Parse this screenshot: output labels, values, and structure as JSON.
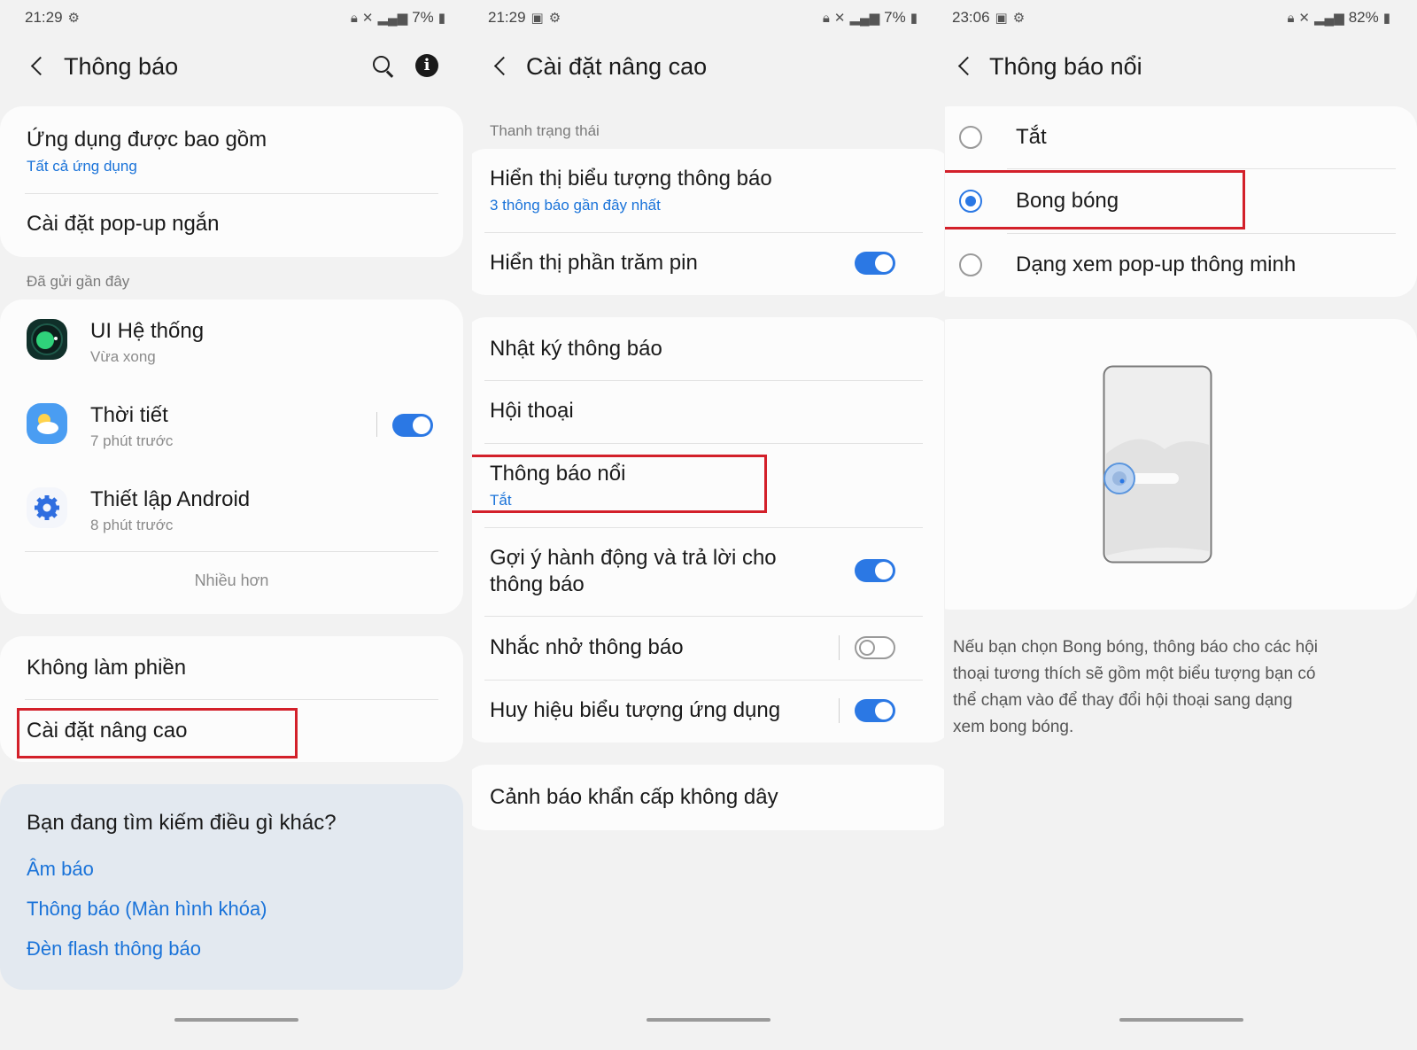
{
  "screen1": {
    "status": {
      "time": "21:29",
      "battery": "7%"
    },
    "title": "Thông báo",
    "included_apps": {
      "label": "Ứng dụng được bao gồm",
      "value": "Tất cả ứng dụng"
    },
    "popup_settings": "Cài đặt pop-up ngắn",
    "recent_section": "Đã gửi gần đây",
    "recent_apps": [
      {
        "name": "UI Hệ thống",
        "time": "Vừa xong"
      },
      {
        "name": "Thời tiết",
        "time": "7 phút trước",
        "toggle": true
      },
      {
        "name": "Thiết lập Android",
        "time": "8 phút trước"
      }
    ],
    "more": "Nhiều hơn",
    "dnd": "Không làm phiền",
    "advanced": "Cài đặt nâng cao",
    "search_card": {
      "heading": "Bạn đang tìm kiếm điều gì khác?",
      "links": [
        "Âm báo",
        "Thông báo (Màn hình khóa)",
        "Đèn flash thông báo"
      ]
    }
  },
  "screen2": {
    "status": {
      "time": "21:29",
      "battery": "7%"
    },
    "title": "Cài đặt nâng cao",
    "status_bar_section": "Thanh trạng thái",
    "show_icons": {
      "label": "Hiển thị biểu tượng thông báo",
      "value": "3 thông báo gần đây nhất"
    },
    "battery_percent": {
      "label": "Hiển thị phần trăm pin",
      "on": true
    },
    "history": "Nhật ký thông báo",
    "conversations": "Hội thoại",
    "floating": {
      "label": "Thông báo nổi",
      "value": "Tắt"
    },
    "suggest": {
      "label_line1": "Gợi ý hành động và trả lời cho",
      "label_line2": "thông báo",
      "on": true
    },
    "reminders": {
      "label": "Nhắc nhở thông báo",
      "on": false
    },
    "badges": {
      "label": "Huy hiệu biểu tượng ứng dụng",
      "on": true
    },
    "wireless_alerts": "Cảnh báo khẩn cấp không dây"
  },
  "screen3": {
    "status": {
      "time": "23:06",
      "battery": "82%"
    },
    "title": "Thông báo nổi",
    "options": [
      {
        "label": "Tắt",
        "selected": false
      },
      {
        "label": "Bong bóng",
        "selected": true
      },
      {
        "label": "Dạng xem pop-up thông minh",
        "selected": false
      }
    ],
    "description_lines": [
      "Nếu bạn chọn Bong bóng, thông báo cho các hội",
      "thoại tương thích sẽ gồm một biểu tượng bạn có",
      "thể chạm vào để thay đổi hội thoại sang dạng",
      "xem bong bóng."
    ]
  },
  "colors": {
    "accent": "#2b78e4",
    "link": "#1a73d9",
    "highlight": "#d3202a",
    "background": "#f2f2f2",
    "card": "#fcfcfc"
  },
  "icons": [
    "settings-gear-icon",
    "lock-icon",
    "mute-icon",
    "signal-icon",
    "battery-icon",
    "image-icon",
    "back-arrow-icon",
    "search-icon",
    "info-icon"
  ]
}
